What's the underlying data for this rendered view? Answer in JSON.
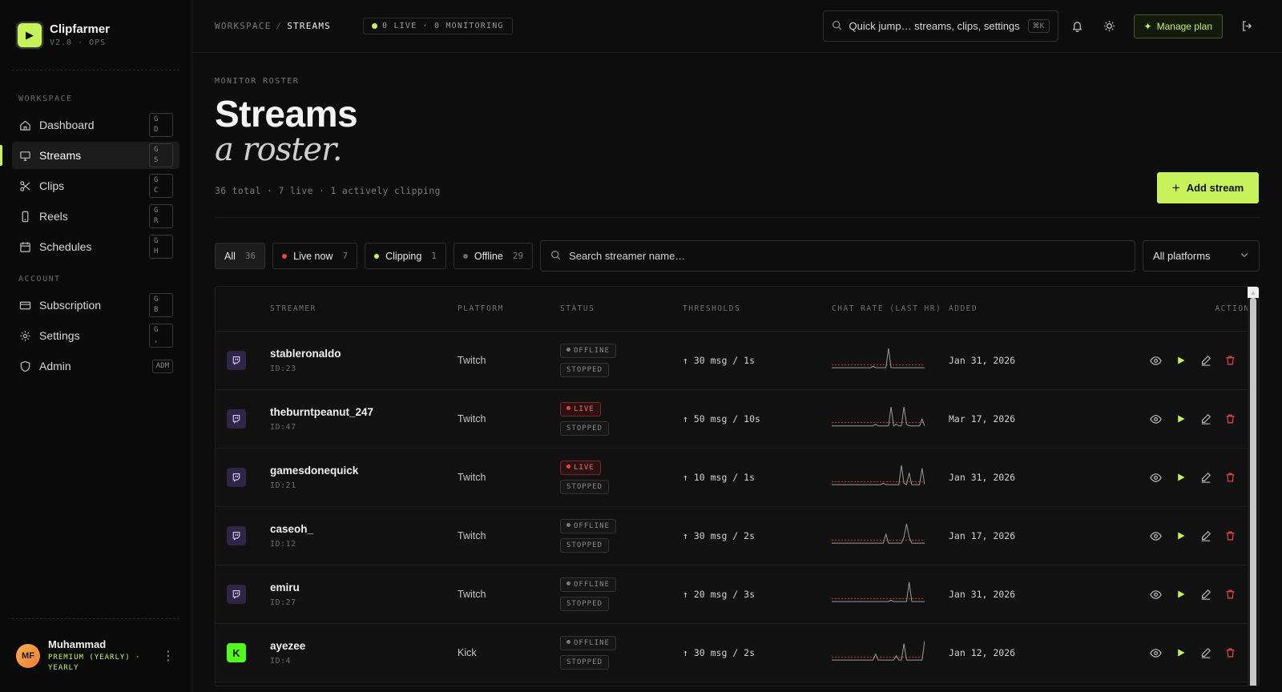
{
  "brand": {
    "name": "Clipfarmer",
    "version": "V2.0 · OPS"
  },
  "sidebar": {
    "workspace_label": "WORKSPACE",
    "account_label": "ACCOUNT",
    "workspace_items": [
      {
        "label": "Dashboard",
        "kbd": "G\nD",
        "icon": "home-icon"
      },
      {
        "label": "Streams",
        "kbd": "G\nS",
        "icon": "monitor-icon",
        "active": true
      },
      {
        "label": "Clips",
        "kbd": "G\nC",
        "icon": "scissors-icon"
      },
      {
        "label": "Reels",
        "kbd": "G\nR",
        "icon": "phone-icon"
      },
      {
        "label": "Schedules",
        "kbd": "G\nH",
        "icon": "calendar-icon"
      }
    ],
    "account_items": [
      {
        "label": "Subscription",
        "kbd": "G\nB",
        "icon": "card-icon"
      },
      {
        "label": "Settings",
        "kbd": "G\n,",
        "icon": "gear-icon"
      },
      {
        "label": "Admin",
        "kbd": "ADM",
        "icon": "shield-icon"
      }
    ]
  },
  "user": {
    "initials": "MF",
    "name": "Muhammad",
    "plan": "PREMIUM (YEARLY) · YEARLY"
  },
  "topbar": {
    "crumb_root": "WORKSPACE",
    "crumb_sep": "/",
    "crumb_current": "STREAMS",
    "status": "0 LIVE · 0 MONITORING",
    "quick_placeholder": "Quick jump… streams, clips, settings",
    "quick_kbd": "⌘K",
    "manage_label": "Manage plan"
  },
  "page": {
    "eyebrow": "MONITOR ROSTER",
    "title": "Streams",
    "subtitle": "a roster.",
    "summary": "36 total · 7 live · 1 actively clipping",
    "add_label": "Add stream"
  },
  "filters": {
    "all": {
      "label": "All",
      "count": "36"
    },
    "live": {
      "label": "Live now",
      "count": "7"
    },
    "clipping": {
      "label": "Clipping",
      "count": "1"
    },
    "offline": {
      "label": "Offline",
      "count": "29"
    },
    "search_placeholder": "Search streamer name…",
    "platform_select": "All platforms"
  },
  "table": {
    "headers": {
      "streamer": "STREAMER",
      "platform": "PLATFORM",
      "status": "STATUS",
      "thresholds": "THRESHOLDS",
      "chat_rate": "CHAT RATE (LAST HR)",
      "added": "ADDED",
      "actions": "ACTIONS"
    },
    "rows": [
      {
        "name": "stableronaldo",
        "id": "ID:23",
        "platform": "Twitch",
        "status": "OFFLINE",
        "state": "STOPPED",
        "threshold": "↑ 30 msg / 1s",
        "added": "Jan 31, 2026",
        "spark": [
          1,
          1,
          1,
          1,
          1,
          1,
          1,
          1,
          1,
          1,
          1,
          1,
          1,
          1,
          1,
          1,
          2,
          1,
          1,
          1,
          1,
          1,
          14,
          1,
          1,
          1,
          1,
          1,
          1,
          1,
          1,
          1,
          1,
          1,
          1,
          1,
          1
        ]
      },
      {
        "name": "theburntpeanut_247",
        "id": "ID:47",
        "platform": "Twitch",
        "status": "LIVE",
        "state": "STOPPED",
        "threshold": "↑ 50 msg / 10s",
        "added": "Mar 17, 2026",
        "spark": [
          1,
          1,
          1,
          1,
          1,
          1,
          1,
          1,
          1,
          1,
          1,
          1,
          1,
          1,
          1,
          1,
          1,
          2,
          1,
          1,
          1,
          1,
          1,
          12,
          1,
          2,
          1,
          1,
          12,
          2,
          1,
          1,
          1,
          1,
          1,
          5,
          1
        ]
      },
      {
        "name": "gamesdonequick",
        "id": "ID:21",
        "platform": "Twitch",
        "status": "LIVE",
        "state": "STOPPED",
        "threshold": "↑ 10 msg / 1s",
        "added": "Jan 31, 2026",
        "spark": [
          1,
          1,
          1,
          1,
          1,
          1,
          1,
          1,
          1,
          1,
          1,
          1,
          1,
          1,
          1,
          1,
          1,
          1,
          1,
          1,
          2,
          1,
          1,
          1,
          1,
          1,
          1,
          14,
          2,
          1,
          9,
          1,
          1,
          1,
          1,
          12,
          1
        ]
      },
      {
        "name": "caseoh_",
        "id": "ID:12",
        "platform": "Twitch",
        "status": "OFFLINE",
        "state": "STOPPED",
        "threshold": "↑ 30 msg / 2s",
        "added": "Jan 17, 2026",
        "spark": [
          1,
          1,
          1,
          1,
          1,
          1,
          1,
          1,
          1,
          1,
          1,
          1,
          1,
          1,
          1,
          1,
          1,
          1,
          1,
          1,
          1,
          7,
          1,
          1,
          1,
          1,
          1,
          1,
          5,
          14,
          5,
          1,
          1,
          1,
          1,
          1,
          1
        ]
      },
      {
        "name": "emiru",
        "id": "ID:27",
        "platform": "Twitch",
        "status": "OFFLINE",
        "state": "STOPPED",
        "threshold": "↑ 20 msg / 3s",
        "added": "Jan 31, 2026",
        "spark": [
          1,
          1,
          1,
          1,
          1,
          1,
          1,
          1,
          1,
          1,
          1,
          1,
          1,
          1,
          1,
          1,
          1,
          1,
          1,
          1,
          1,
          1,
          1,
          2,
          1,
          1,
          1,
          1,
          1,
          1,
          14,
          1,
          1,
          1,
          1,
          1,
          1
        ]
      },
      {
        "name": "ayezee",
        "id": "ID:4",
        "platform": "Kick",
        "status": "OFFLINE",
        "state": "STOPPED",
        "threshold": "↑ 30 msg / 2s",
        "added": "Jan 12, 2026",
        "spark": [
          1,
          1,
          1,
          1,
          1,
          1,
          1,
          1,
          1,
          1,
          1,
          1,
          1,
          1,
          1,
          1,
          1,
          5,
          1,
          1,
          1,
          1,
          1,
          1,
          1,
          4,
          1,
          1,
          12,
          1,
          1,
          1,
          1,
          1,
          1,
          1,
          14
        ]
      }
    ]
  },
  "colors": {
    "accent": "#c7f25a",
    "live": "#ef4444",
    "twitch": "#9146ff",
    "kick": "#53fc18"
  }
}
